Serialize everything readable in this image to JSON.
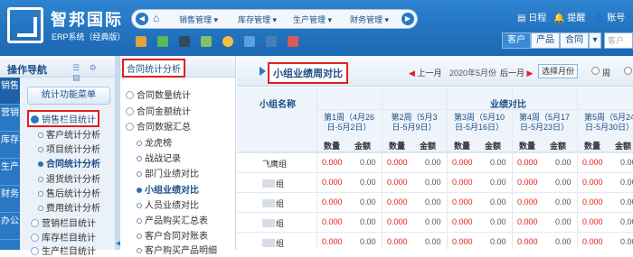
{
  "app": {
    "brand": "智邦国际",
    "subtitle": "ERP系统（经典版）"
  },
  "topnav": {
    "menus": [
      "销售管理",
      "库存管理",
      "生产管理",
      "财务管理"
    ]
  },
  "right_links": [
    "日程",
    "提醒",
    "账号"
  ],
  "segments": [
    "客户",
    "产品",
    "合同"
  ],
  "search": {
    "placeholder": "客户"
  },
  "sidenav": {
    "title": "操作导航",
    "vtabs": [
      "销售",
      "营销",
      "库存",
      "生产",
      "财务",
      "办公"
    ],
    "function_menu": "统计功能菜单",
    "items": [
      "销售栏目统计",
      "客户统计分析",
      "项目统计分析",
      "合同统计分析",
      "退货统计分析",
      "售后统计分析",
      "费用统计分析",
      "营销栏目统计",
      "库存栏目统计",
      "生产栏目统计"
    ]
  },
  "treepanel": {
    "title": "合同统计分析",
    "items": [
      "合同数量统计",
      "合同金额统计",
      "合同数据汇总",
      "龙虎榜",
      "战战记录",
      "部门业绩对比",
      "小组业绩对比",
      "人员业绩对比",
      "产品购买汇总表",
      "客户合同对账表",
      "客户购买产品明细"
    ]
  },
  "main": {
    "title": "小组业绩周对比",
    "prev": "上一月",
    "current": "2020年5月份",
    "next": "后一月",
    "choose": "选择月份",
    "radio_label": "周"
  },
  "table": {
    "group_header": "小组名称",
    "compare_header": "业绩对比",
    "weeks": [
      "第1周（4月26日-5月2日）",
      "第2周（5月3日-5月9日）",
      "第3周（5月10日-5月16日）",
      "第4周（5月17日-5月23日）",
      "第5周（5月24日-5月30日）"
    ],
    "qty": "数量",
    "amt": "金额",
    "rows": [
      {
        "name": "飞鹰组",
        "qty": "0.000",
        "amt": "0.00"
      },
      {
        "name": "组",
        "qty": "0.000",
        "amt": "0.00"
      },
      {
        "name": "组",
        "qty": "0.000",
        "amt": "0.00"
      },
      {
        "name": "组",
        "qty": "0.000",
        "amt": "0.00"
      },
      {
        "name": "组",
        "qty": "0.000",
        "amt": "0.00"
      }
    ]
  },
  "colors": {
    "header_blue": "#2a78c4",
    "highlight_red": "#e02020",
    "qty_red": "#e02020"
  }
}
